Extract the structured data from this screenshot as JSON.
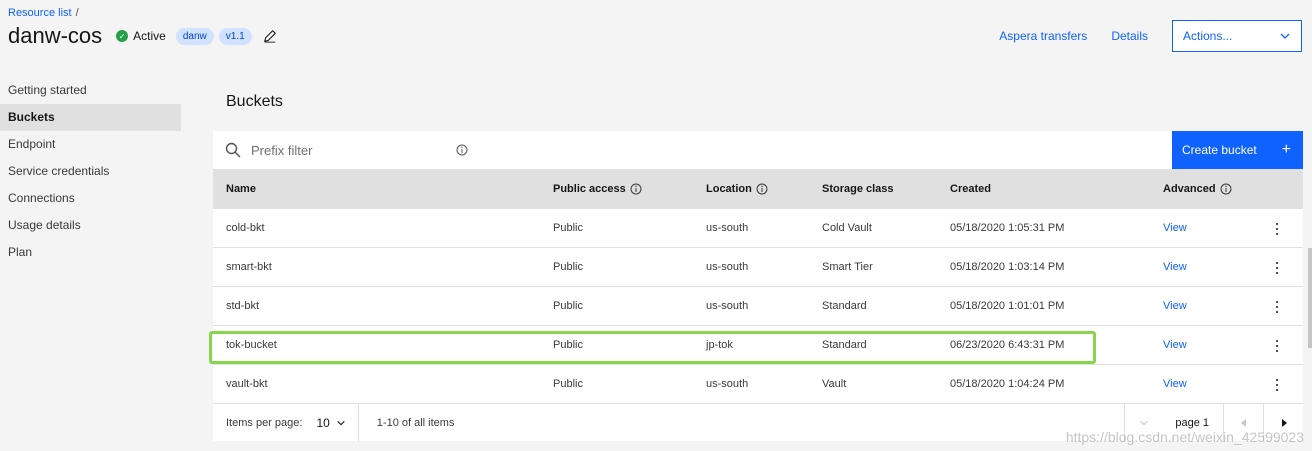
{
  "breadcrumb": {
    "link": "Resource list",
    "separator": "/"
  },
  "header": {
    "title": "danw-cos",
    "status": "Active",
    "tags": [
      "danw",
      "v1.1"
    ],
    "links": [
      "Aspera transfers",
      "Details"
    ],
    "actions_label": "Actions..."
  },
  "sidebar": {
    "items": [
      {
        "label": "Getting started"
      },
      {
        "label": "Buckets"
      },
      {
        "label": "Endpoint"
      },
      {
        "label": "Service credentials"
      },
      {
        "label": "Connections"
      },
      {
        "label": "Usage details"
      },
      {
        "label": "Plan"
      }
    ],
    "active": "Buckets"
  },
  "main": {
    "section_title": "Buckets",
    "search_placeholder": "Prefix filter",
    "create_label": "Create bucket",
    "create_icon": "+",
    "columns": [
      "Name",
      "Public access",
      "Location",
      "Storage class",
      "Created",
      "Advanced"
    ],
    "rows": [
      {
        "name": "cold-bkt",
        "access": "Public",
        "location": "us-south",
        "class": "Cold Vault",
        "created": "05/18/2020 1:05:31 PM",
        "advanced": "View"
      },
      {
        "name": "smart-bkt",
        "access": "Public",
        "location": "us-south",
        "class": "Smart Tier",
        "created": "05/18/2020 1:03:14 PM",
        "advanced": "View"
      },
      {
        "name": "std-bkt",
        "access": "Public",
        "location": "us-south",
        "class": "Standard",
        "created": "05/18/2020 1:01:01 PM",
        "advanced": "View"
      },
      {
        "name": "tok-bucket",
        "access": "Public",
        "location": "jp-tok",
        "class": "Standard",
        "created": "06/23/2020 6:43:31 PM",
        "advanced": "View"
      },
      {
        "name": "vault-bkt",
        "access": "Public",
        "location": "us-south",
        "class": "Vault",
        "created": "05/18/2020 1:04:24 PM",
        "advanced": "View"
      }
    ],
    "highlighted_row": "tok-bucket"
  },
  "pagination": {
    "items_per_page_label": "Items per page:",
    "items_per_page": "10",
    "range": "1-10 of all items",
    "page": "page 1"
  },
  "watermark": "https://blog.csdn.net/weixin_42599023",
  "colors": {
    "primary": "#0f62fe",
    "active_status": "#24a148",
    "highlight": "#86d54a",
    "tag_bg": "#d0e2ff"
  }
}
